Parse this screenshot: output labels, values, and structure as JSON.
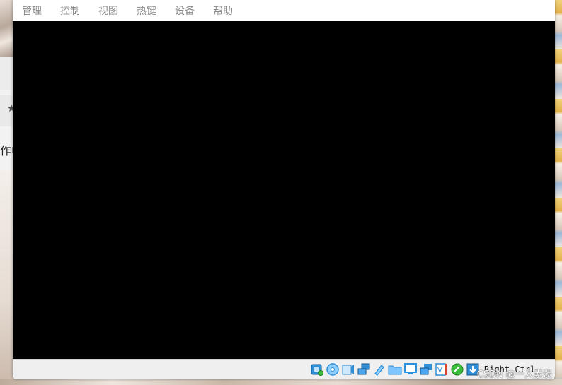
{
  "background": {
    "left_text": "作中",
    "left_star": "★"
  },
  "watermark": "CSDN @一人素淡",
  "vm": {
    "menu": [
      {
        "id": "manage",
        "label": "管理"
      },
      {
        "id": "control",
        "label": "控制"
      },
      {
        "id": "view",
        "label": "视图"
      },
      {
        "id": "hotkeys",
        "label": "热键"
      },
      {
        "id": "devices",
        "label": "设备"
      },
      {
        "id": "help",
        "label": "帮助"
      }
    ],
    "status_icons": [
      "hard-disk-icon",
      "optical-disk-icon",
      "audio-icon",
      "network-icon",
      "usb-icon",
      "shared-folders-icon",
      "display-icon",
      "recording-icon",
      "cpu-vt-icon",
      "mouse-integration-icon",
      "keyboard-capture-icon"
    ],
    "host_key_label": "Right Ctrl",
    "colors": {
      "screen": "#000000",
      "menu_text": "#8a8a8a",
      "statusbar": "#efefef",
      "icon_blue": "#2f8fd8"
    }
  }
}
